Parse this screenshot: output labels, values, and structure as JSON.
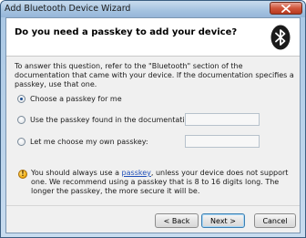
{
  "window": {
    "title": "Add Bluetooth Device Wizard",
    "close_icon": "close-icon"
  },
  "header": {
    "title": "Do you need a passkey to add your device?",
    "icon": "bluetooth-icon"
  },
  "description": "To answer this question, refer to the \"Bluetooth\" section of the documentation that came with your device. If the documentation specifies a passkey, use that one.",
  "options": [
    {
      "label": "Choose a passkey for me",
      "checked": true
    },
    {
      "label": "Use the passkey found in the documentation:",
      "checked": false,
      "value": ""
    },
    {
      "label": "Let me choose my own passkey:",
      "checked": false,
      "value": ""
    }
  ],
  "note": {
    "icon": "warning-icon",
    "prefix": "You should always use a ",
    "link": "passkey",
    "suffix": ", unless your device does not support one. We recommend using a passkey that is 8 to 16 digits long. The longer the passkey, the more secure it will be."
  },
  "buttons": {
    "back": "< Back",
    "next": "Next >",
    "cancel": "Cancel"
  },
  "colors": {
    "accent": "#1f4fb8",
    "close": "#d0553a",
    "bluetooth_bg": "#1a1a1a"
  }
}
